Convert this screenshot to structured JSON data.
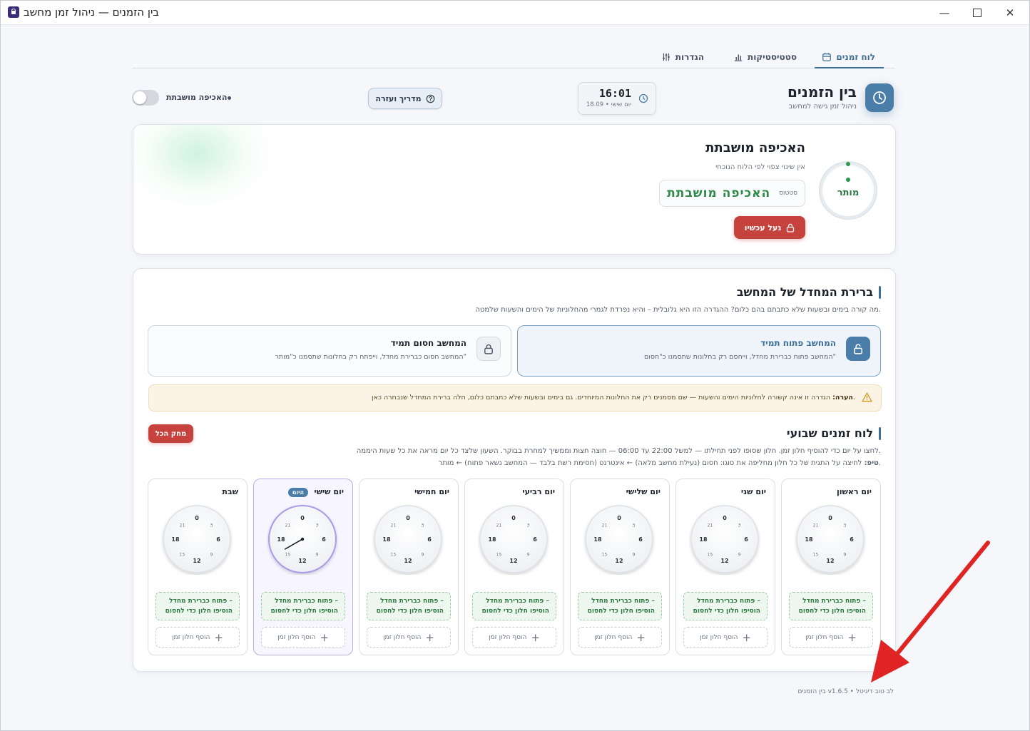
{
  "window": {
    "title": "בין הזמנים — ניהול זמן מחשב",
    "app_icon": "lock-app-icon"
  },
  "tabs": [
    {
      "label": "לוח זמנים",
      "icon": "calendar-icon",
      "active": true
    },
    {
      "label": "סטטיסטיקות",
      "icon": "bar-chart-icon",
      "active": false
    },
    {
      "label": "הגדרות",
      "icon": "sliders-icon",
      "active": false
    }
  ],
  "brand": {
    "title": "בין הזמנים",
    "subtitle": "ניהול זמן גישה למחשב"
  },
  "clock": {
    "time": "16:01",
    "date": "יום שישי • 18.09"
  },
  "help": {
    "label": "מדריך ועזרה"
  },
  "enforcement": {
    "label": "האכיפה מושבתת",
    "enabled": false
  },
  "status_card": {
    "ring_label": "מותר",
    "title": "האכיפה מושבתת",
    "subtitle": "אין שינוי צפוי לפי הלוח הנוכחי",
    "status_key": "סטטוס",
    "status_value": "האכיפה מושבתת",
    "lock_button": "נעל עכשיו"
  },
  "default_section": {
    "title": "ברירת המחדל של המחשב",
    "description": "מה קורה בימים ובשעות שלא כתבתם בהם כלום? ההגדרה הזו היא גלובלית – והיא נפרדת לגמרי מהחלוניות של הימים והשעות שלמטה.",
    "options": [
      {
        "title": "המחשב פתוח תמיד",
        "description": "המחשב פתוח כברירת מחדל, וייחסם רק בחלונות שתסמנו כ\"חסום\"",
        "selected": true
      },
      {
        "title": "המחשב חסום תמיד",
        "description": "המחשב חסום כברירת מחדל, וייפתח רק בחלונות שתסמנו כ\"מותר\"",
        "selected": false
      }
    ],
    "note_label": "הערה:",
    "note_text": "הגדרה זו אינה קשורה לחלוניות הימים והשעות — שם מסמנים רק את החלונות המיוחדים. גם בימים ובשעות שלא כתבתם כלום, חלה ברירת המחדל שנבחרה כאן."
  },
  "weekly": {
    "title": "לוח זמנים שבועי",
    "clear_button": "מחק הכל",
    "description": "לחצו על יום כדי להוסיף חלון זמן. חלון שסופו לפני תחילתו — למשל 22:00 עד 06:00 — חוצה חצות וממשיך למחרת בבוקר. השעון שלצד כל יום מראה את כל שעות היממה.",
    "tip_label": "טיפ:",
    "tip_text": "לחיצה על התגית של כל חלון מחליפה את סוגו: חסום (נעילת מחשב מלאה) ← אינטרנט (חסימת רשת בלבד — המחשב נשאר פתוח) ← מותר.",
    "today_badge": "היום",
    "dial_labels": {
      "h0": "0",
      "h3": "3",
      "h6": "6",
      "h9": "9",
      "h12": "12",
      "h15": "15",
      "h18": "18",
      "h21": "21"
    },
    "status_line1": "פתוח כברירת מחדל –",
    "status_line2": "הוסיפו חלון כדי לחסום",
    "add_label": "הוסף חלון זמן",
    "days": [
      {
        "name": "יום ראשון",
        "today": false
      },
      {
        "name": "יום שני",
        "today": false
      },
      {
        "name": "יום שלישי",
        "today": false
      },
      {
        "name": "יום רביעי",
        "today": false
      },
      {
        "name": "יום חמישי",
        "today": false
      },
      {
        "name": "יום שישי",
        "today": true
      },
      {
        "name": "שבת",
        "today": false
      }
    ]
  },
  "footer": {
    "text": "בין הזמנים v1.6.5 • לב טוב דיגיטל"
  },
  "colors": {
    "accent": "#4a7ea8",
    "danger": "#c6423d",
    "success": "#2f8a4a",
    "annotation_arrow": "#e02424"
  }
}
